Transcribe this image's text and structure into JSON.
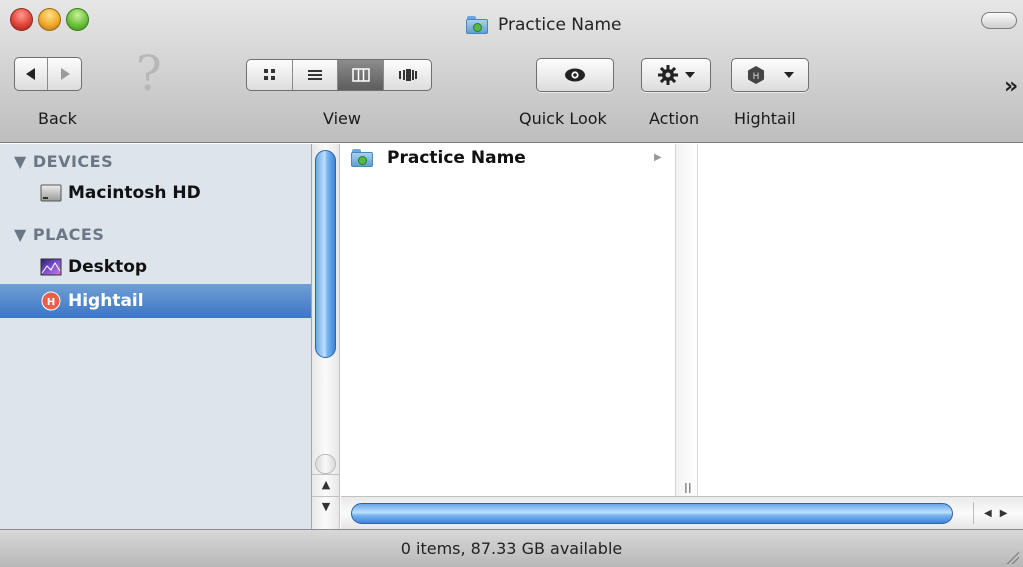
{
  "window": {
    "title": "Practice Name"
  },
  "toolbar": {
    "back_label": "Back",
    "view_label": "View",
    "quicklook_label": "Quick Look",
    "action_label": "Action",
    "hightail_label": "Hightail",
    "overflow_glyph": "»",
    "help_glyph": "?"
  },
  "sidebar": {
    "devices_header": "▼ DEVICES",
    "places_header": "▼ PLACES",
    "devices": [
      {
        "label": "Macintosh HD",
        "icon": "hard-drive-icon"
      }
    ],
    "places": [
      {
        "label": "Desktop",
        "icon": "desktop-icon"
      },
      {
        "label": "Hightail",
        "icon": "hightail-icon",
        "selected": true
      }
    ]
  },
  "browser": {
    "column1": [
      {
        "label": "Practice Name",
        "icon": "shared-folder-icon",
        "arrow": "▶"
      }
    ],
    "column_grip": "II"
  },
  "status": {
    "text": "0 items, 87.33 GB available"
  },
  "colors": {
    "selection": "#3c76c3",
    "sidebar_bg": "#dde4ec",
    "scroll_thumb": "#6aa7e7"
  }
}
